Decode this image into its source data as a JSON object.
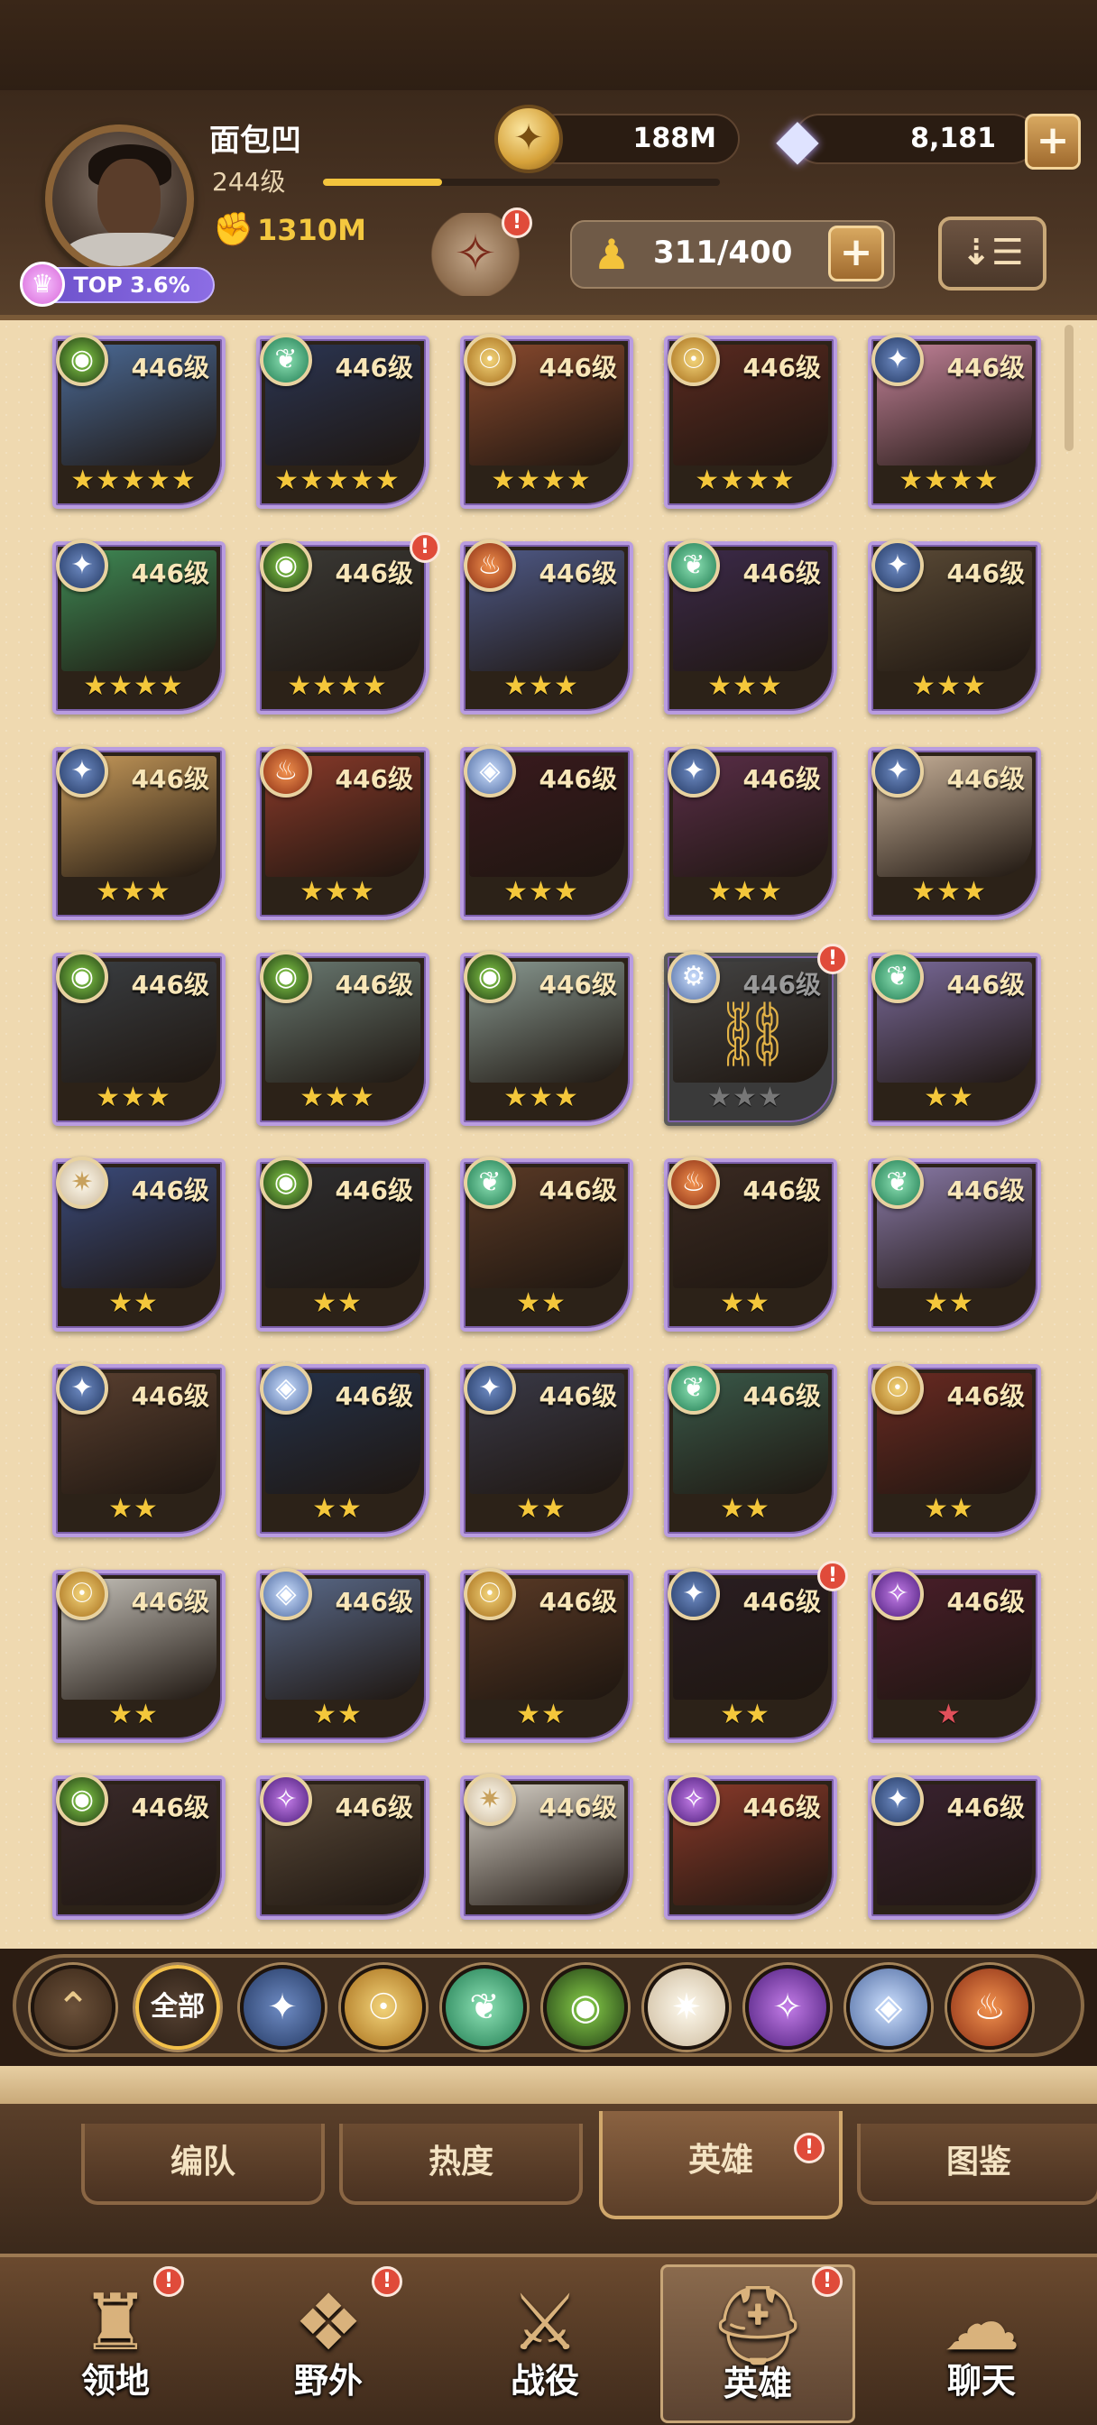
{
  "player": {
    "name": "面包凹",
    "level": "244级",
    "power": "1310M",
    "rank": "TOP 3.6%",
    "xp_fraction": 0.3
  },
  "currency": {
    "gold": "188M",
    "diamonds": "8,181"
  },
  "roster": {
    "count": "311/400"
  },
  "colors": {
    "accent_gold": "#f3c43d",
    "parchment": "#efd9b0",
    "frame_purple": "#b99ce0",
    "badge_red": "#e04b3a"
  },
  "heroes": [
    {
      "level": "446级",
      "stars": "★★★★★",
      "faction": "eye-icon",
      "art": "#4b6a96"
    },
    {
      "level": "446级",
      "stars": "★★★★★",
      "faction": "leaf-icon",
      "art": "#2b3552"
    },
    {
      "level": "446级",
      "stars": "★★★★",
      "faction": "gold-icon",
      "art": "#8a4a2e"
    },
    {
      "level": "446级",
      "stars": "★★★★",
      "faction": "gold-icon",
      "art": "#5a2a20"
    },
    {
      "level": "446级",
      "stars": "★★★★",
      "faction": "star-icon",
      "art": "#c4839a"
    },
    {
      "level": "446级",
      "stars": "★★★★",
      "faction": "star-icon",
      "art": "#3f8a55"
    },
    {
      "level": "446级",
      "stars": "★★★★",
      "faction": "eye-icon",
      "art": "#3b3a36"
    },
    {
      "level": "446级",
      "stars": "★★★",
      "faction": "fire-icon",
      "art": "#4f5a88"
    },
    {
      "level": "446级",
      "stars": "★★★",
      "faction": "leaf-icon",
      "art": "#3c2a4a"
    },
    {
      "level": "446级",
      "stars": "★★★",
      "faction": "star-icon",
      "art": "#5a4a36"
    },
    {
      "level": "446级",
      "stars": "★★★",
      "faction": "star-icon",
      "art": "#c79a5a"
    },
    {
      "level": "446级",
      "stars": "★★★",
      "faction": "fire-icon",
      "art": "#8a3a2a"
    },
    {
      "level": "446级",
      "stars": "★★★",
      "faction": "shield-icon",
      "art": "#3a1a1e"
    },
    {
      "level": "446级",
      "stars": "★★★",
      "faction": "star-icon",
      "art": "#5a2e48"
    },
    {
      "level": "446级",
      "stars": "★★★",
      "faction": "star-icon",
      "art": "#c9b29a"
    },
    {
      "level": "446级",
      "stars": "★★★",
      "faction": "eye-icon",
      "art": "#3a3e42"
    },
    {
      "level": "446级",
      "stars": "★★★",
      "faction": "eye-icon",
      "art": "#6a7a72"
    },
    {
      "level": "446级",
      "stars": "★★★",
      "faction": "eye-icon",
      "art": "#8a9a92"
    },
    {
      "level": "446级",
      "stars": "★★★",
      "faction": "lock-icon",
      "art": "#444444",
      "locked": true
    },
    {
      "level": "446级",
      "stars": "★★",
      "faction": "leaf-icon",
      "art": "#7a6a9a"
    },
    {
      "level": "446级",
      "stars": "★★",
      "faction": "light-icon",
      "art": "#3a4a7a"
    },
    {
      "level": "446级",
      "stars": "★★",
      "faction": "eye-icon",
      "art": "#2e2e30"
    },
    {
      "level": "446级",
      "stars": "★★",
      "faction": "leaf-icon",
      "art": "#5a3a26"
    },
    {
      "level": "446级",
      "stars": "★★",
      "faction": "fire-icon",
      "art": "#3a2a22"
    },
    {
      "level": "446级",
      "stars": "★★",
      "faction": "leaf-icon",
      "art": "#8a7aa8"
    },
    {
      "level": "446级",
      "stars": "★★",
      "faction": "star-icon",
      "art": "#5a4030"
    },
    {
      "level": "446级",
      "stars": "★★",
      "faction": "shield-icon",
      "art": "#25324a"
    },
    {
      "level": "446级",
      "stars": "★★",
      "faction": "star-icon",
      "art": "#3a3a48"
    },
    {
      "level": "446级",
      "stars": "★★",
      "faction": "leaf-icon",
      "art": "#3a5a4a"
    },
    {
      "level": "446级",
      "stars": "★★",
      "faction": "gold-icon",
      "art": "#6a2a22"
    },
    {
      "level": "446级",
      "stars": "★★",
      "faction": "gold-icon",
      "art": "#c6c2ba"
    },
    {
      "level": "446级",
      "stars": "★★",
      "faction": "shield-icon",
      "art": "#5a6a8a"
    },
    {
      "level": "446级",
      "stars": "★★",
      "faction": "gold-icon",
      "art": "#5a3a26"
    },
    {
      "level": "446级",
      "stars": "★★",
      "faction": "star-icon",
      "art": "#2a1e22"
    },
    {
      "level": "446级",
      "stars": "★",
      "faction": "void-icon",
      "art": "#4a1e2a"
    },
    {
      "level": "446级",
      "stars": "",
      "faction": "eye-icon",
      "art": "#3a2a2a"
    },
    {
      "level": "446级",
      "stars": "",
      "faction": "void-icon",
      "art": "#5a4a3a"
    },
    {
      "level": "446级",
      "stars": "",
      "faction": "light-icon",
      "art": "#d8d2c8"
    },
    {
      "level": "446级",
      "stars": "",
      "faction": "void-icon",
      "art": "#8a3a2a"
    },
    {
      "level": "446级",
      "stars": "",
      "faction": "star-icon",
      "art": "#3a2230"
    }
  ],
  "filters": {
    "all_label": "全部",
    "icons": [
      "star-icon",
      "gold-icon",
      "leaf-icon",
      "eye-icon",
      "light-icon",
      "void-icon",
      "shield-icon",
      "fire-icon"
    ]
  },
  "subtabs": [
    "编队",
    "热度",
    "英雄",
    "图鉴"
  ],
  "nav": [
    "领地",
    "野外",
    "战役",
    "英雄",
    "聊天"
  ]
}
